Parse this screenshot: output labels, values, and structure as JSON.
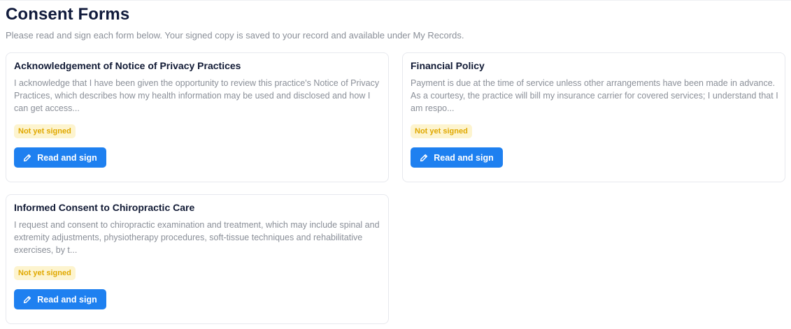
{
  "header": {
    "title": "Consent Forms",
    "subtitle": "Please read and sign each form below. Your signed copy is saved to your record and available under My Records."
  },
  "forms": [
    {
      "title": "Acknowledgement of Notice of Privacy Practices",
      "description": "I acknowledge that I have been given the opportunity to review this practice's Notice of Privacy Practices, which describes how my health information may be used and disclosed and how I can get access...",
      "status": "Not yet signed",
      "button_label": "Read and sign",
      "button_icon": "pen-icon"
    },
    {
      "title": "Financial Policy",
      "description": "Payment is due at the time of service unless other arrangements have been made in advance. As a courtesy, the practice will bill my insurance carrier for covered services; I understand that I am respo...",
      "status": "Not yet signed",
      "button_label": "Read and sign",
      "button_icon": "pen-icon"
    },
    {
      "title": "Informed Consent to Chiropractic Care",
      "description": "I request and consent to chiropractic examination and treatment, which may include spinal and extremity adjustments, physiotherapy procedures, soft-tissue techniques and rehabilitative exercises, by t...",
      "status": "Not yet signed",
      "button_label": "Read and sign",
      "button_icon": "pen-icon"
    }
  ],
  "colors": {
    "accent": "#1e80f0",
    "badge_bg": "#fdf4cf",
    "badge_text": "#e0a800",
    "title": "#101a3b",
    "muted_text": "#8a8f98"
  }
}
